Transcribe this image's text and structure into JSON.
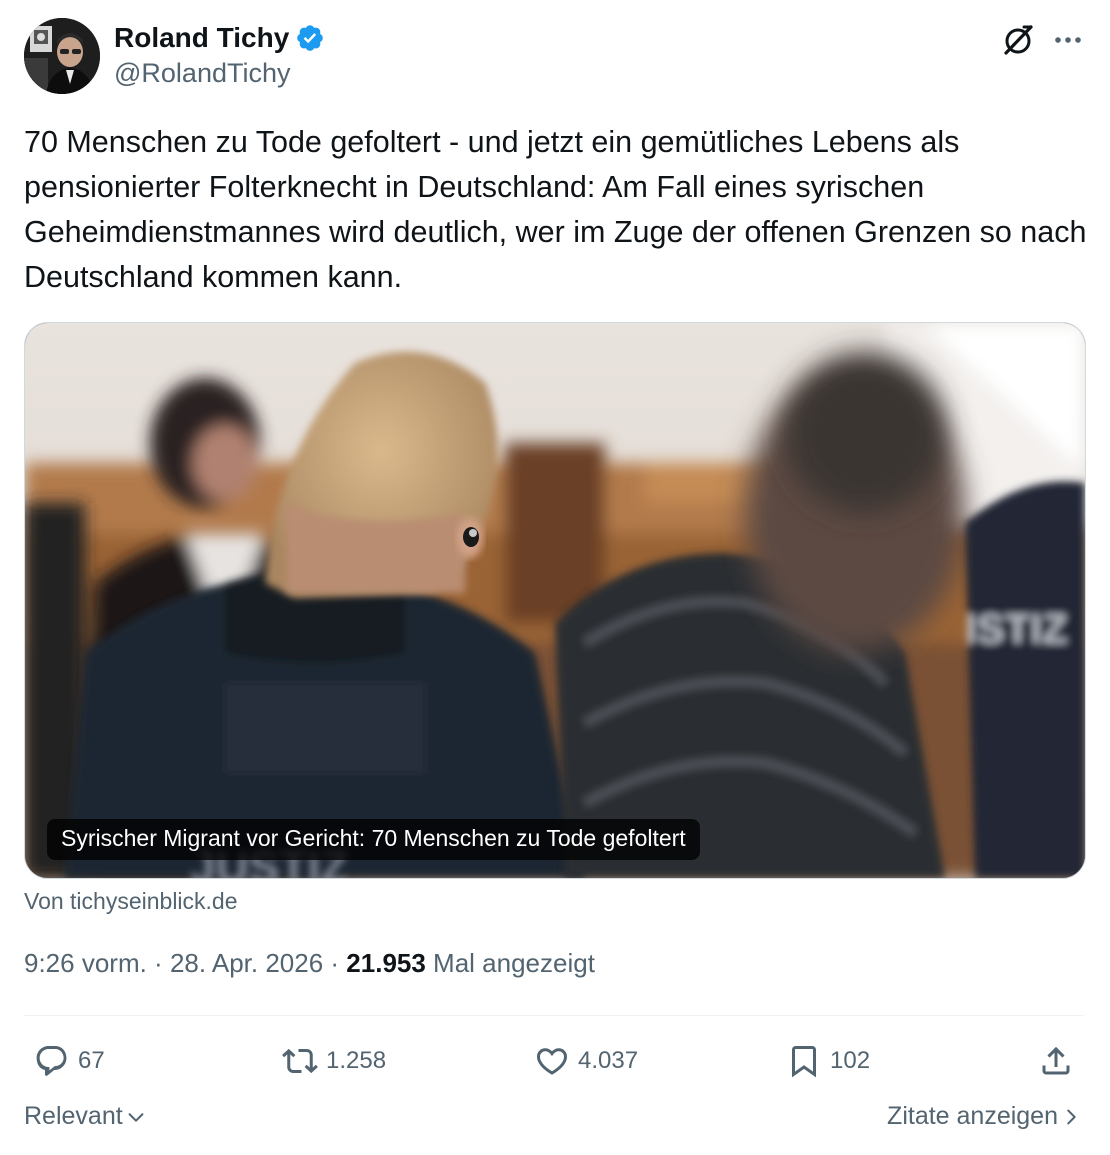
{
  "author": {
    "name": "Roland Tichy",
    "handle": "@RolandTichy",
    "verified": true
  },
  "tweet": {
    "text": "70 Menschen zu Tode gefoltert - und jetzt ein gemütliches Lebens als pensionierter Folterknecht in Deutschland: Am Fall eines syrischen Geheimdienstmannes wird deutlich, wer im Zuge der offenen Grenzen so nach Deutschland kommen kann."
  },
  "card": {
    "caption": "Syrischer Migrant vor Gericht: 70 Menschen zu Tode gefoltert",
    "source": "Von tichyseinblick.de"
  },
  "meta": {
    "time": "9:26 vorm.",
    "sep1": " · ",
    "date": "28. Apr. 2026",
    "sep2": " · ",
    "views": "21.953",
    "views_label": " Mal angezeigt"
  },
  "actions": {
    "replies": "67",
    "reposts": "1.258",
    "likes": "4.037",
    "bookmarks": "102"
  },
  "footer": {
    "sort_label": "Relevant",
    "quotes_label": "Zitate anzeigen"
  },
  "colors": {
    "text": "#0f1419",
    "secondary": "#536471",
    "verified": "#1d9bf0"
  }
}
